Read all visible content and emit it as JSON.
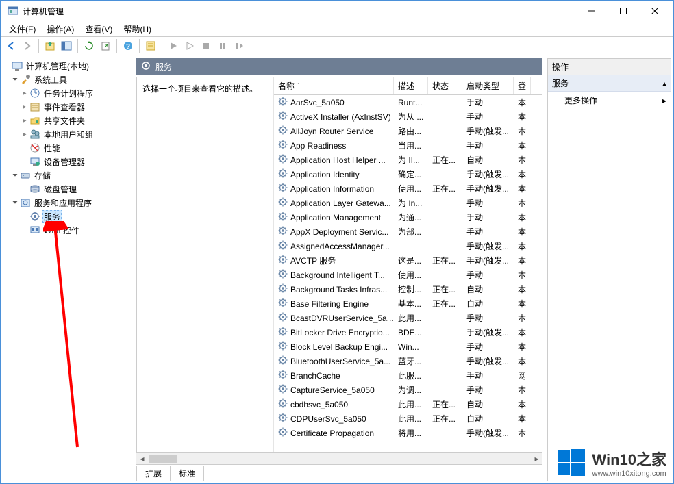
{
  "window": {
    "title": "计算机管理"
  },
  "menu": {
    "file": "文件(F)",
    "action": "操作(A)",
    "view": "查看(V)",
    "help": "帮助(H)"
  },
  "tree": {
    "root": "计算机管理(本地)",
    "systemTools": {
      "label": "系统工具",
      "children": [
        "任务计划程序",
        "事件查看器",
        "共享文件夹",
        "本地用户和组",
        "性能",
        "设备管理器"
      ]
    },
    "storage": {
      "label": "存储",
      "children": [
        "磁盘管理"
      ]
    },
    "servicesApps": {
      "label": "服务和应用程序",
      "children": [
        "服务",
        "WMI 控件"
      ]
    }
  },
  "centerHeader": {
    "title": "服务"
  },
  "descPanel": {
    "hint": "选择一个项目来查看它的描述。"
  },
  "columns": {
    "name": "名称",
    "desc": "描述",
    "status": "状态",
    "startup": "启动类型",
    "logon": "登"
  },
  "services": [
    {
      "name": "AarSvc_5a050",
      "desc": "Runt...",
      "status": "",
      "startup": "手动",
      "logon": "本"
    },
    {
      "name": "ActiveX Installer (AxInstSV)",
      "desc": "为从 ...",
      "status": "",
      "startup": "手动",
      "logon": "本"
    },
    {
      "name": "AllJoyn Router Service",
      "desc": "路由...",
      "status": "",
      "startup": "手动(触发...",
      "logon": "本"
    },
    {
      "name": "App Readiness",
      "desc": "当用...",
      "status": "",
      "startup": "手动",
      "logon": "本"
    },
    {
      "name": "Application Host Helper ...",
      "desc": "为 II...",
      "status": "正在...",
      "startup": "自动",
      "logon": "本"
    },
    {
      "name": "Application Identity",
      "desc": "确定...",
      "status": "",
      "startup": "手动(触发...",
      "logon": "本"
    },
    {
      "name": "Application Information",
      "desc": "使用...",
      "status": "正在...",
      "startup": "手动(触发...",
      "logon": "本"
    },
    {
      "name": "Application Layer Gatewa...",
      "desc": "为 In...",
      "status": "",
      "startup": "手动",
      "logon": "本"
    },
    {
      "name": "Application Management",
      "desc": "为通...",
      "status": "",
      "startup": "手动",
      "logon": "本"
    },
    {
      "name": "AppX Deployment Servic...",
      "desc": "为部...",
      "status": "",
      "startup": "手动",
      "logon": "本"
    },
    {
      "name": "AssignedAccessManager...",
      "desc": "",
      "status": "",
      "startup": "手动(触发...",
      "logon": "本"
    },
    {
      "name": "AVCTP 服务",
      "desc": "这是...",
      "status": "正在...",
      "startup": "手动(触发...",
      "logon": "本"
    },
    {
      "name": "Background Intelligent T...",
      "desc": "使用...",
      "status": "",
      "startup": "手动",
      "logon": "本"
    },
    {
      "name": "Background Tasks Infras...",
      "desc": "控制...",
      "status": "正在...",
      "startup": "自动",
      "logon": "本"
    },
    {
      "name": "Base Filtering Engine",
      "desc": "基本...",
      "status": "正在...",
      "startup": "自动",
      "logon": "本"
    },
    {
      "name": "BcastDVRUserService_5a...",
      "desc": "此用...",
      "status": "",
      "startup": "手动",
      "logon": "本"
    },
    {
      "name": "BitLocker Drive Encryptio...",
      "desc": "BDE...",
      "status": "",
      "startup": "手动(触发...",
      "logon": "本"
    },
    {
      "name": "Block Level Backup Engi...",
      "desc": "Win...",
      "status": "",
      "startup": "手动",
      "logon": "本"
    },
    {
      "name": "BluetoothUserService_5a...",
      "desc": "蓝牙...",
      "status": "",
      "startup": "手动(触发...",
      "logon": "本"
    },
    {
      "name": "BranchCache",
      "desc": "此服...",
      "status": "",
      "startup": "手动",
      "logon": "网"
    },
    {
      "name": "CaptureService_5a050",
      "desc": "为调...",
      "status": "",
      "startup": "手动",
      "logon": "本"
    },
    {
      "name": "cbdhsvc_5a050",
      "desc": "此用...",
      "status": "正在...",
      "startup": "自动",
      "logon": "本"
    },
    {
      "name": "CDPUserSvc_5a050",
      "desc": "此用...",
      "status": "正在...",
      "startup": "自动",
      "logon": "本"
    },
    {
      "name": "Certificate Propagation",
      "desc": "将用...",
      "status": "",
      "startup": "手动(触发...",
      "logon": "本"
    }
  ],
  "tabs": {
    "extended": "扩展",
    "standard": "标准"
  },
  "actions": {
    "header": "操作",
    "group": "服务",
    "more": "更多操作"
  },
  "watermark": {
    "title": "Win10之家",
    "url": "www.win10xitong.com"
  }
}
